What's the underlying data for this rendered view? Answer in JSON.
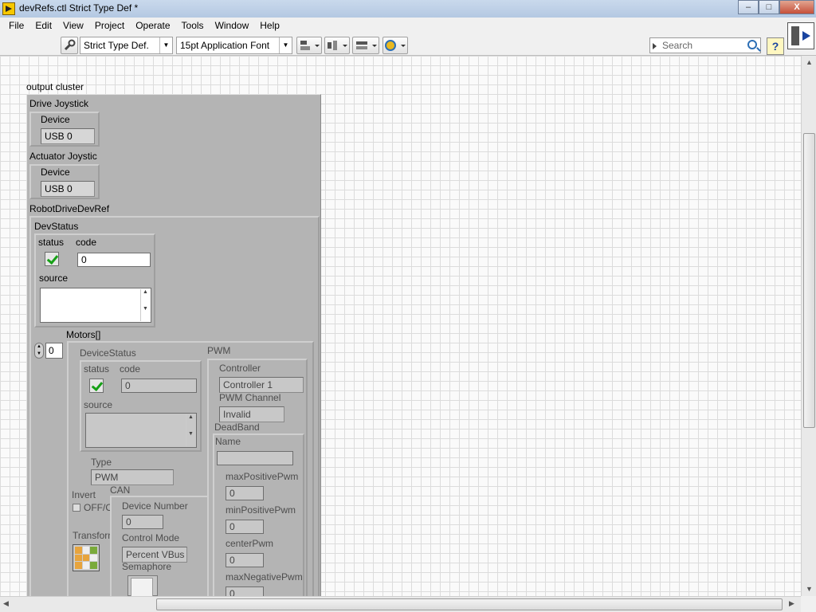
{
  "window": {
    "title": "devRefs.ctl Strict Type Def *",
    "minimize": "–",
    "maximize": "□",
    "close": "X"
  },
  "menu": [
    "File",
    "Edit",
    "View",
    "Project",
    "Operate",
    "Tools",
    "Window",
    "Help"
  ],
  "toolbar": {
    "control_type": "Strict Type Def.",
    "font": "15pt Application Font",
    "search_placeholder": "Search",
    "help": "?"
  },
  "panel": {
    "cluster_label": "output cluster",
    "drive_joystick": {
      "label": "Drive Joystick",
      "device_label": "Device",
      "device_value": "USB 0"
    },
    "actuator_joystick": {
      "label": "Actuator Joystic",
      "device_label": "Device",
      "device_value": "USB 0"
    },
    "robot_drive": {
      "label": "RobotDriveDevRef",
      "dev_status": {
        "label": "DevStatus",
        "status_label": "status",
        "code_label": "code",
        "code_value": "0",
        "source_label": "source"
      },
      "motors": {
        "label": "Motors[]",
        "index": "0",
        "device_status": {
          "label": "DeviceStatus",
          "status_label": "status",
          "code_label": "code",
          "code_value": "0",
          "source_label": "source"
        },
        "type_label": "Type",
        "type_value": "PWM",
        "invert_label": "Invert",
        "invert_value": "OFF/O",
        "transform_label": "Transform",
        "can": {
          "label": "CAN",
          "device_number_label": "Device Number",
          "device_number_value": "0",
          "control_mode_label": "Control Mode",
          "control_mode_value": "Percent VBus",
          "semaphore_label": "Semaphore"
        },
        "pwm": {
          "label": "PWM",
          "controller_label": "Controller",
          "controller_value": "Controller 1",
          "pwm_channel_label": "PWM Channel",
          "pwm_channel_value": "Invalid",
          "deadband_label": "DeadBand",
          "name_label": "Name",
          "max_positive_label": "maxPositivePwm",
          "max_positive_value": "0",
          "min_positive_label": "minPositivePwm",
          "min_positive_value": "0",
          "center_label": "centerPwm",
          "center_value": "0",
          "max_negative_label": "maxNegativePwm",
          "max_negative_value": "0"
        }
      }
    }
  }
}
